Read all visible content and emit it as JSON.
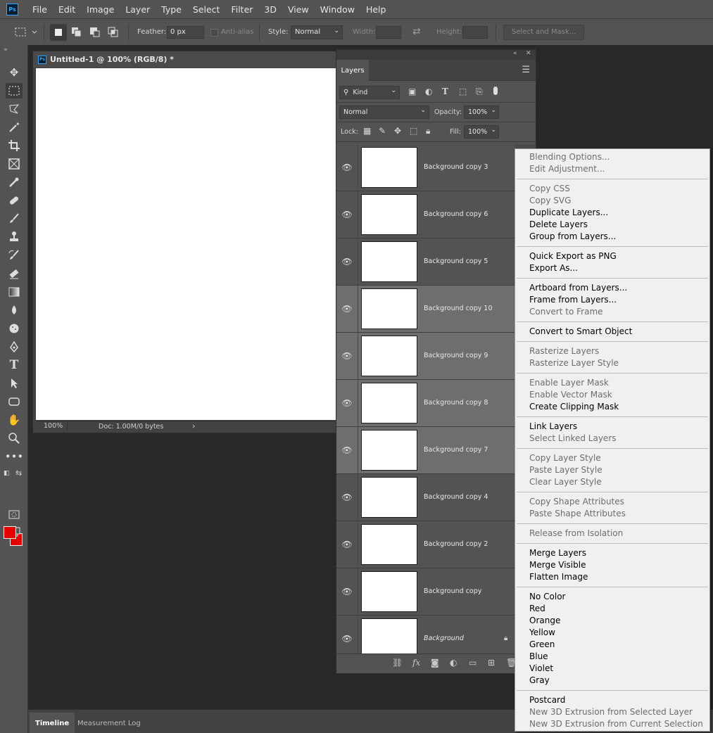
{
  "app": {
    "logo_text": "Ps"
  },
  "menubar": {
    "items": [
      "File",
      "Edit",
      "Image",
      "Layer",
      "Type",
      "Select",
      "Filter",
      "3D",
      "View",
      "Window",
      "Help"
    ]
  },
  "options": {
    "feather_label": "Feather:",
    "feather_value": "0 px",
    "antialias_label": "Anti-alias",
    "style_label": "Style:",
    "style_value": "Normal",
    "width_label": "Width:",
    "height_label": "Height:",
    "select_mask_label": "Select and Mask..."
  },
  "toolbar": {
    "foreground_color": "#e60000",
    "background_color": "#e60000"
  },
  "document": {
    "title": "Untitled-1 @ 100% (RGB/8) *",
    "zoom": "100%",
    "doc_info": "Doc: 1.00M/0 bytes"
  },
  "layers_panel": {
    "tab_label": "Layers",
    "kind_label": "Kind",
    "blend_mode": "Normal",
    "opacity_label": "Opacity:",
    "opacity_value": "100%",
    "lock_label": "Lock:",
    "fill_label": "Fill:",
    "fill_value": "100%",
    "layers": [
      {
        "name": "Background copy 3",
        "selected": false
      },
      {
        "name": "Background copy 6",
        "selected": false
      },
      {
        "name": "Background copy 5",
        "selected": false
      },
      {
        "name": "Background copy 10",
        "selected": true
      },
      {
        "name": "Background copy 9",
        "selected": true
      },
      {
        "name": "Background copy 8",
        "selected": true
      },
      {
        "name": "Background copy 7",
        "selected": true
      },
      {
        "name": "Background copy 4",
        "selected": false
      },
      {
        "name": "Background copy 2",
        "selected": false
      },
      {
        "name": "Background copy",
        "selected": false
      },
      {
        "name": "Background",
        "selected": false,
        "italic": true,
        "locked": true
      }
    ]
  },
  "bottom_tabs": {
    "timeline": "Timeline",
    "measurement_log": "Measurement Log"
  },
  "context_menu": {
    "groups": [
      [
        {
          "label": "Blending Options...",
          "enabled": false
        },
        {
          "label": "Edit Adjustment...",
          "enabled": false
        }
      ],
      [
        {
          "label": "Copy CSS",
          "enabled": false
        },
        {
          "label": "Copy SVG",
          "enabled": false
        },
        {
          "label": "Duplicate Layers...",
          "enabled": true
        },
        {
          "label": "Delete Layers",
          "enabled": true
        },
        {
          "label": "Group from Layers...",
          "enabled": true
        }
      ],
      [
        {
          "label": "Quick Export as PNG",
          "enabled": true
        },
        {
          "label": "Export As...",
          "enabled": true
        }
      ],
      [
        {
          "label": "Artboard from Layers...",
          "enabled": true
        },
        {
          "label": "Frame from Layers...",
          "enabled": true
        },
        {
          "label": "Convert to Frame",
          "enabled": false
        }
      ],
      [
        {
          "label": "Convert to Smart Object",
          "enabled": true
        }
      ],
      [
        {
          "label": "Rasterize Layers",
          "enabled": false
        },
        {
          "label": "Rasterize Layer Style",
          "enabled": false
        }
      ],
      [
        {
          "label": "Enable Layer Mask",
          "enabled": false
        },
        {
          "label": "Enable Vector Mask",
          "enabled": false
        },
        {
          "label": "Create Clipping Mask",
          "enabled": true
        }
      ],
      [
        {
          "label": "Link Layers",
          "enabled": true
        },
        {
          "label": "Select Linked Layers",
          "enabled": false
        }
      ],
      [
        {
          "label": "Copy Layer Style",
          "enabled": false
        },
        {
          "label": "Paste Layer Style",
          "enabled": false
        },
        {
          "label": "Clear Layer Style",
          "enabled": false
        }
      ],
      [
        {
          "label": "Copy Shape Attributes",
          "enabled": false
        },
        {
          "label": "Paste Shape Attributes",
          "enabled": false
        }
      ],
      [
        {
          "label": "Release from Isolation",
          "enabled": false
        }
      ],
      [
        {
          "label": "Merge Layers",
          "enabled": true
        },
        {
          "label": "Merge Visible",
          "enabled": true
        },
        {
          "label": "Flatten Image",
          "enabled": true
        }
      ],
      [
        {
          "label": "No Color",
          "enabled": true
        },
        {
          "label": "Red",
          "enabled": true
        },
        {
          "label": "Orange",
          "enabled": true
        },
        {
          "label": "Yellow",
          "enabled": true
        },
        {
          "label": "Green",
          "enabled": true
        },
        {
          "label": "Blue",
          "enabled": true
        },
        {
          "label": "Violet",
          "enabled": true
        },
        {
          "label": "Gray",
          "enabled": true
        }
      ],
      [
        {
          "label": "Postcard",
          "enabled": true
        },
        {
          "label": "New 3D Extrusion from Selected Layer",
          "enabled": false
        },
        {
          "label": "New 3D Extrusion from Current Selection",
          "enabled": false
        }
      ]
    ]
  }
}
